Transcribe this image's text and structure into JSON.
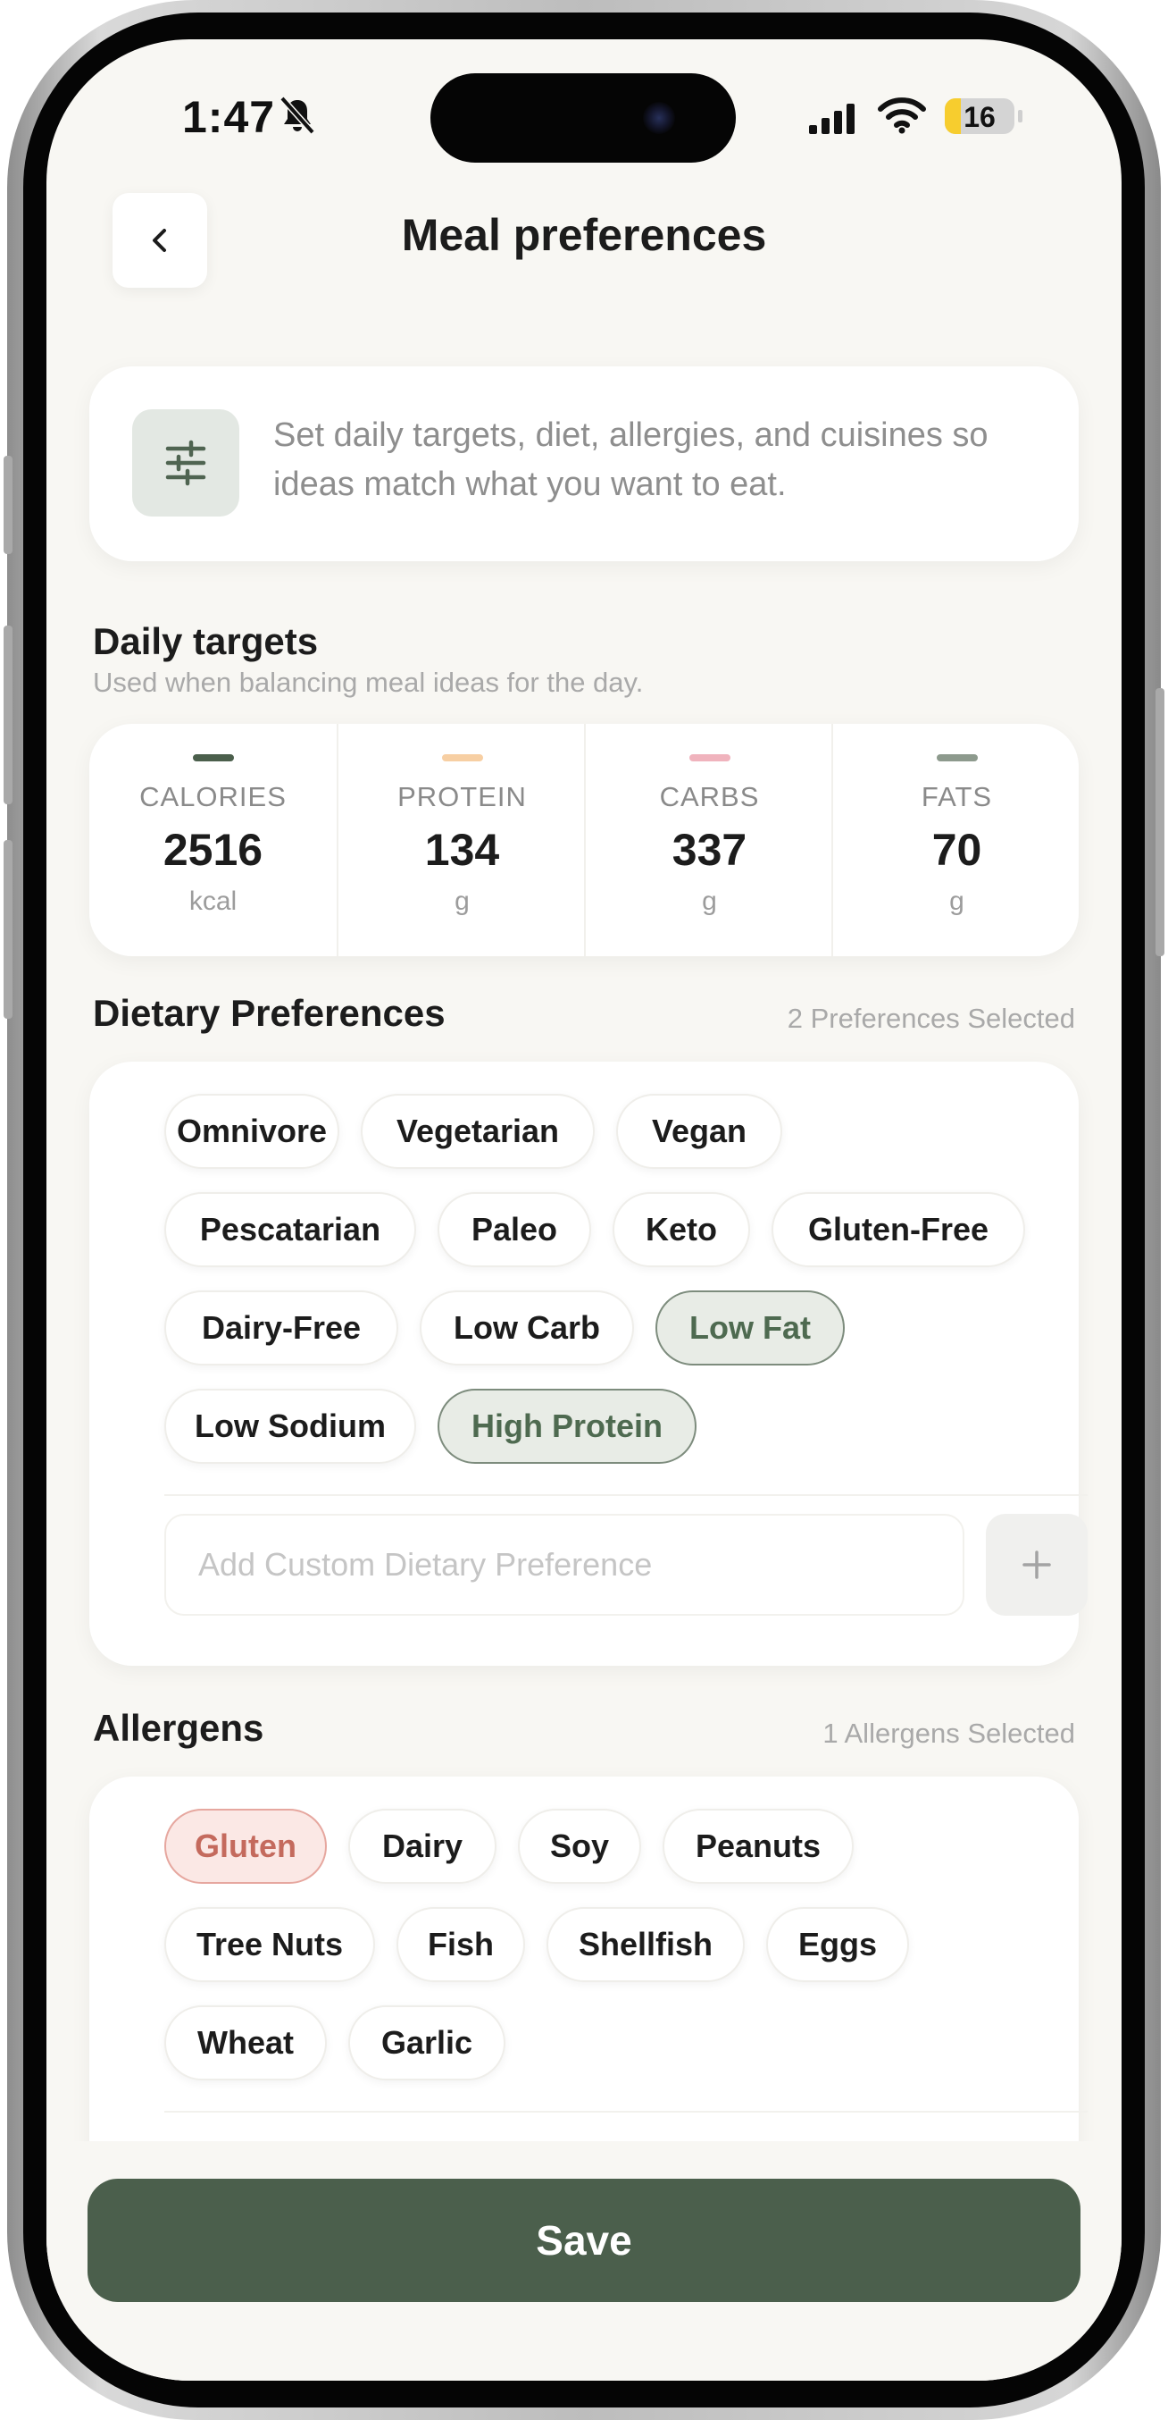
{
  "status_bar": {
    "time": "1:47",
    "battery_level": "16"
  },
  "header": {
    "title": "Meal preferences"
  },
  "intro": {
    "text": "Set daily targets, diet, allergies, and cuisines so ideas match what you want to eat."
  },
  "daily_targets": {
    "title": "Daily targets",
    "subtitle": "Used when balancing meal ideas for the day.",
    "macros": [
      {
        "label": "CALORIES",
        "value": "2516",
        "unit": "kcal",
        "color": "#4b5f4c"
      },
      {
        "label": "PROTEIN",
        "value": "134",
        "unit": "g",
        "color": "#f7cfa3"
      },
      {
        "label": "CARBS",
        "value": "337",
        "unit": "g",
        "color": "#f0b3bd"
      },
      {
        "label": "FATS",
        "value": "70",
        "unit": "g",
        "color": "#8d9a8d"
      }
    ]
  },
  "dietary": {
    "title": "Dietary Preferences",
    "count_text": "2 Preferences Selected",
    "chips": [
      {
        "label": "Omnivore",
        "selected": false
      },
      {
        "label": "Vegetarian",
        "selected": false
      },
      {
        "label": "Vegan",
        "selected": false
      },
      {
        "label": "Pescatarian",
        "selected": false
      },
      {
        "label": "Paleo",
        "selected": false
      },
      {
        "label": "Keto",
        "selected": false
      },
      {
        "label": "Gluten-Free",
        "selected": false
      },
      {
        "label": "Dairy-Free",
        "selected": false
      },
      {
        "label": "Low Carb",
        "selected": false
      },
      {
        "label": "Low Fat",
        "selected": true
      },
      {
        "label": "Low Sodium",
        "selected": false
      },
      {
        "label": "High Protein",
        "selected": true
      }
    ],
    "custom_placeholder": "Add Custom Dietary Preference"
  },
  "allergens": {
    "title": "Allergens",
    "count_text": "1 Allergens Selected",
    "chips": [
      {
        "label": "Gluten",
        "selected": true
      },
      {
        "label": "Dairy",
        "selected": false
      },
      {
        "label": "Soy",
        "selected": false
      },
      {
        "label": "Peanuts",
        "selected": false
      },
      {
        "label": "Tree Nuts",
        "selected": false
      },
      {
        "label": "Fish",
        "selected": false
      },
      {
        "label": "Shellfish",
        "selected": false
      },
      {
        "label": "Eggs",
        "selected": false
      },
      {
        "label": "Wheat",
        "selected": false
      },
      {
        "label": "Garlic",
        "selected": false
      }
    ]
  },
  "save_label": "Save",
  "colors": {
    "accent": "#4b5f4c",
    "background": "#f8f7f3",
    "allergen_selected": "#c46a5d"
  }
}
